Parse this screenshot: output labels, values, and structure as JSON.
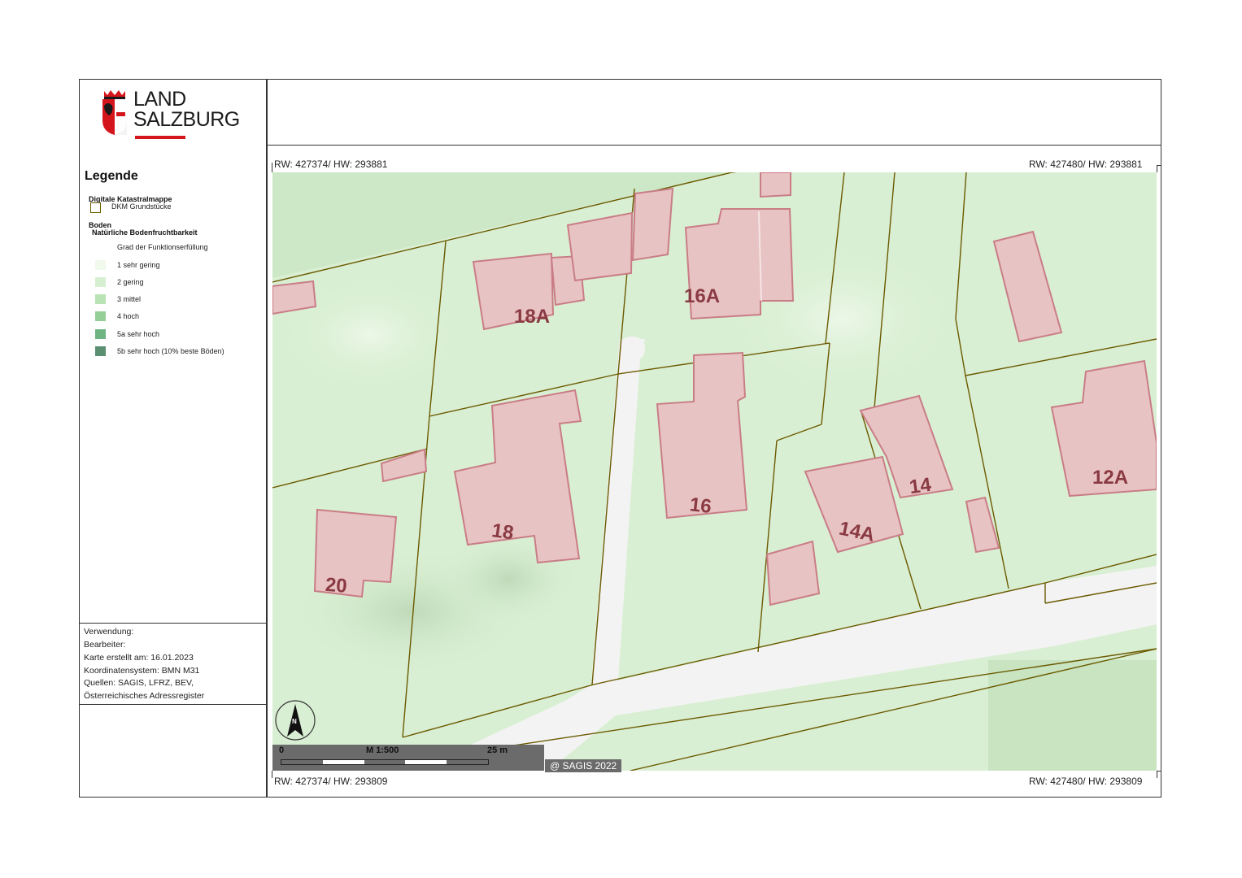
{
  "header": {
    "logo_line1": "LAND",
    "logo_line2": "SALZBURG"
  },
  "legend": {
    "title": "Legende",
    "group1_title": "Digitale Katastralmappe",
    "group1_item": "DKM Grundstücke",
    "group2_title": "Boden",
    "group2_subtitle": "Natürliche Bodenfruchtbarkeit",
    "group2_caption": "Grad der Funktionserfüllung",
    "classes": [
      {
        "label": "1 sehr gering",
        "color": "#f1f8ec"
      },
      {
        "label": "2 gering",
        "color": "#d7efd1"
      },
      {
        "label": "3 mittel",
        "color": "#b9e2b5"
      },
      {
        "label": "4 hoch",
        "color": "#93cf96"
      },
      {
        "label": "5a sehr hoch",
        "color": "#6fb483"
      },
      {
        "label": "5b sehr hoch (10% beste Böden)",
        "color": "#5b8f72"
      }
    ]
  },
  "meta": {
    "usage": "Verwendung:",
    "editor": "Bearbeiter:",
    "created": "Karte erstellt am: 16.01.2023",
    "crs": "Koordinatensystem: BMN M31",
    "sources": "Quellen: SAGIS, LFRZ, BEV,",
    "sources2": "Österreichisches Adressregister"
  },
  "coords": {
    "top_left": "RW: 427374/ HW: 293881",
    "top_right": "RW: 427480/ HW: 293881",
    "bottom_left": "RW: 427374/ HW: 293809",
    "bottom_right": "RW: 427480/ HW: 293809"
  },
  "scale": {
    "zero": "0",
    "label": "M 1:500",
    "end": "25 m"
  },
  "north_label": "N",
  "copyright": "@ SAGIS 2022",
  "buildings": {
    "b18a": "18A",
    "b16a": "16A",
    "b18": "18",
    "b16": "16",
    "b20": "20",
    "b14": "14",
    "b14a": "14A",
    "b12a": "12A"
  },
  "colors": {
    "building_fill": "#e8c3c3",
    "building_stroke": "#c97d86",
    "parcel_line": "#6b5a00",
    "map_bg": "#d9efd3",
    "road": "#f2f2f2"
  }
}
